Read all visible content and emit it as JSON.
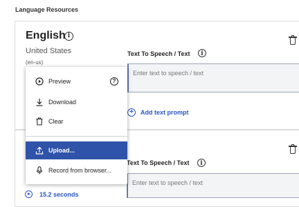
{
  "section": {
    "title": "Language Resources"
  },
  "language": {
    "name": "English",
    "region": "United States",
    "locale": "(en-us)"
  },
  "tts": {
    "label": "Text To Speech / Text",
    "placeholder": "Enter text to speech / text",
    "add_prompt": "Add text prompt"
  },
  "menu": {
    "items": [
      {
        "label": "Preview"
      },
      {
        "label": "Download"
      },
      {
        "label": "Clear"
      },
      {
        "label": "Upload..."
      },
      {
        "label": "Record from browser..."
      }
    ]
  },
  "audio": {
    "duration": "15.2 seconds"
  },
  "colors": {
    "accent": "#2a56c6",
    "highlight": "#2f53a8"
  }
}
